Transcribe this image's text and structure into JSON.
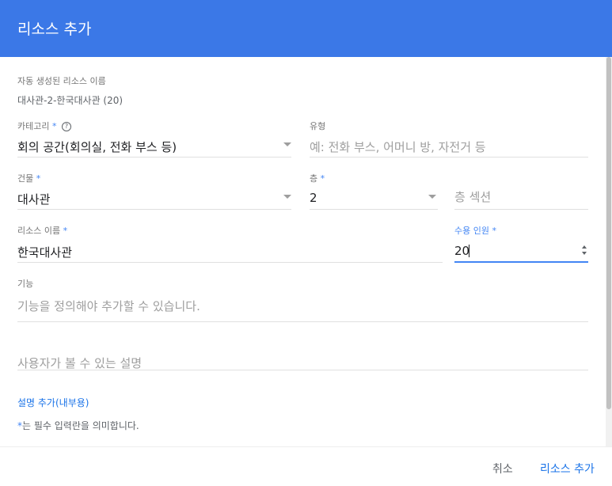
{
  "dialog": {
    "title": "리소스 추가"
  },
  "auto_name": {
    "label": "자동 생성된 리소스 이름",
    "value": "대사관-2-한국대사관 (20)"
  },
  "category": {
    "label": "카테고리",
    "required_mark": "*",
    "help_glyph": "?",
    "value": "회의 공간(회의실, 전화 부스 등)"
  },
  "type": {
    "label": "유형",
    "placeholder": "예: 전화 부스, 어머니 방, 자전거 등"
  },
  "building": {
    "label": "건물",
    "required_mark": "*",
    "value": "대사관"
  },
  "floor": {
    "label": "층",
    "required_mark": "*",
    "value": "2"
  },
  "floor_section": {
    "placeholder": "층 섹션"
  },
  "resource_name": {
    "label": "리소스 이름",
    "required_mark": "*",
    "value": "한국대사관"
  },
  "capacity": {
    "label": "수용 인원",
    "required_mark": "*",
    "value": "20"
  },
  "features": {
    "label": "기능",
    "placeholder": "기능을 정의해야 추가할 수 있습니다."
  },
  "description": {
    "placeholder": "사용자가 볼 수 있는 설명"
  },
  "add_internal_description": "설명 추가(내부용)",
  "required_note": {
    "mark": "*",
    "text": "는 필수 입력란을 의미합니다."
  },
  "footer": {
    "cancel": "취소",
    "add": "리소스 추가"
  },
  "colors": {
    "header": "#3b78e7",
    "accent": "#4285f4",
    "link": "#1a73e8"
  }
}
